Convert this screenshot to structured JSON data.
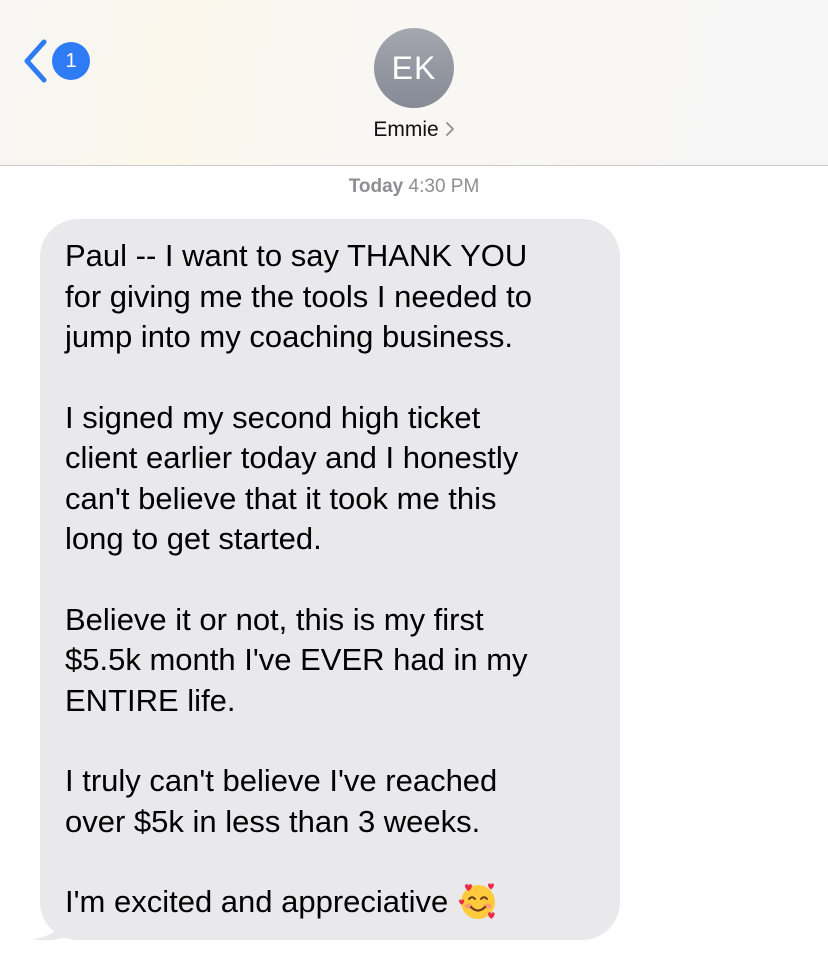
{
  "header": {
    "back_badge_count": "1",
    "avatar_initials": "EK",
    "contact_name": "Emmie"
  },
  "timestamp": {
    "day": "Today",
    "time": "4:30 PM"
  },
  "message": {
    "paragraphs": [
      [
        "Paul -- I want to say THANK YOU",
        "for giving me the tools I needed to",
        "jump into my coaching business."
      ],
      [
        "I signed my second high ticket",
        "client earlier today and I honestly",
        "can't believe that it took me this",
        "long to get started."
      ],
      [
        "Believe it or not, this is my first",
        "$5.5k month I've EVER had in my",
        "ENTIRE life."
      ],
      [
        "I truly can't believe I've reached",
        "over $5k in less than 3 weeks."
      ],
      [
        "I'm excited and appreciative"
      ]
    ],
    "emoji": "smiling-face-with-hearts-icon"
  },
  "colors": {
    "accent_blue": "#2f7bf5",
    "bubble_gray": "#e9e9eb",
    "avatar_gray": "#8e929b",
    "timestamp_gray": "#8e8e93"
  }
}
